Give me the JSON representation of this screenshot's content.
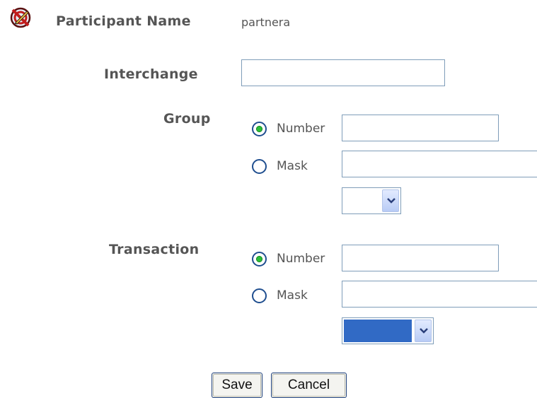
{
  "participant": {
    "label": "Participant Name",
    "value": "partnera",
    "icon": "edit-pencil-icon"
  },
  "interchange": {
    "label": "Interchange",
    "value": ""
  },
  "group": {
    "label": "Group",
    "number_option": "Number",
    "number_selected": true,
    "number_value": "",
    "mask_option": "Mask",
    "mask_selected": false,
    "mask_value": "",
    "select_value": ""
  },
  "transaction": {
    "label": "Transaction",
    "number_option": "Number",
    "number_selected": true,
    "number_value": "",
    "mask_option": "Mask",
    "mask_selected": false,
    "mask_value": "",
    "select_value": ""
  },
  "actions": {
    "save_label": "Save",
    "cancel_label": "Cancel"
  },
  "colors": {
    "input_border": "#7f9db9",
    "radio_selected": "#2bbf3a",
    "select_highlight": "#316ac5"
  }
}
